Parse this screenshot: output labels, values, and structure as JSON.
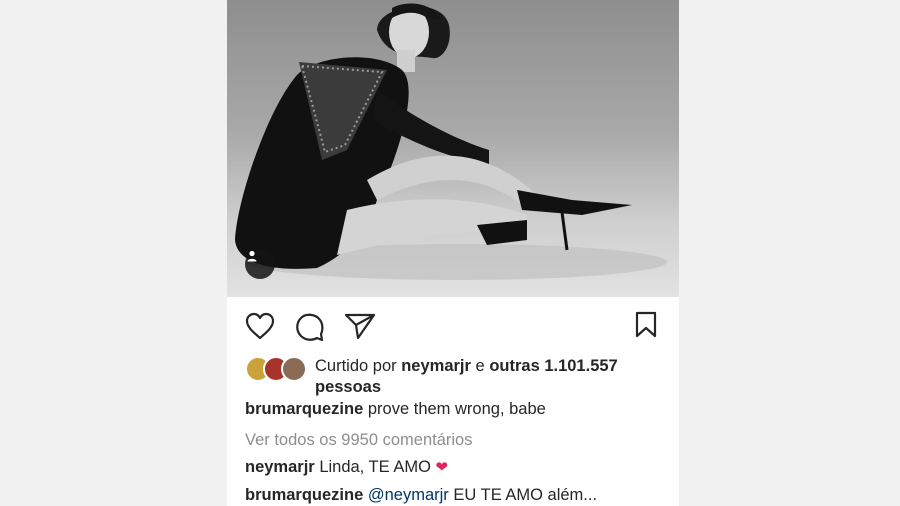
{
  "post": {
    "photo_alt": "photo",
    "liked_by_prefix": "Curtido por",
    "liked_by_user": "neymarjr",
    "liked_by_conj": "e",
    "liked_by_others": "outras 1.101.557 pessoas",
    "caption_user": "brumarquezine",
    "caption_text": "prove them wrong, babe",
    "view_comments": "Ver todos os 9950 comentários",
    "comments": [
      {
        "user": "neymarjr",
        "text": "Linda, TE AMO",
        "emoji": "❤"
      },
      {
        "user": "brumarquezine",
        "mention": "@neymarjr",
        "text": "EU TE AMO além..."
      }
    ]
  },
  "icons": {
    "like": "heart-outline-icon",
    "comment": "comment-bubble-icon",
    "share": "paper-plane-icon",
    "save": "bookmark-icon",
    "tag": "person-tag-icon"
  }
}
